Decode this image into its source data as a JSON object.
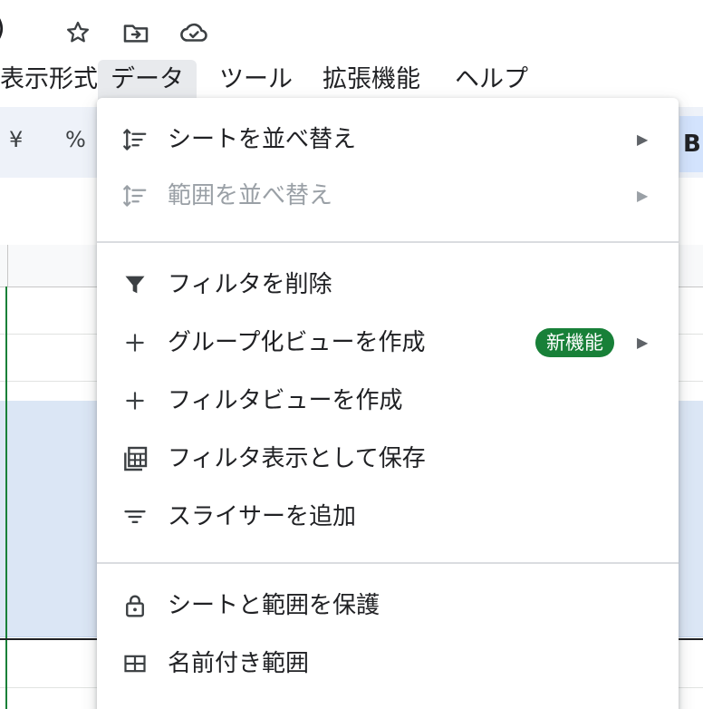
{
  "titlebar": {
    "paren": ")",
    "icons": [
      "star-icon",
      "move-to-folder-icon",
      "cloud-done-icon"
    ]
  },
  "menubar": {
    "items": [
      {
        "label": "表示形式"
      },
      {
        "label": "データ"
      },
      {
        "label": "ツール"
      },
      {
        "label": "拡張機能"
      },
      {
        "label": "ヘルプ"
      }
    ]
  },
  "toolbar": {
    "yen": "¥",
    "percent": "%",
    "bold": "B"
  },
  "dropdown": {
    "items": [
      {
        "label": "シートを並べ替え",
        "icon": "sort-icon",
        "submenu": true,
        "disabled": false
      },
      {
        "label": "範囲を並べ替え",
        "icon": "sort-range-icon",
        "submenu": true,
        "disabled": true
      },
      {
        "label": "フィルタを削除",
        "icon": "filter-icon",
        "submenu": false,
        "disabled": false
      },
      {
        "label": "グループ化ビューを作成",
        "icon": "plus-icon",
        "submenu": true,
        "disabled": false,
        "badge": "新機能"
      },
      {
        "label": "フィルタビューを作成",
        "icon": "plus-icon",
        "submenu": false,
        "disabled": false
      },
      {
        "label": "フィルタ表示として保存",
        "icon": "table-save-icon",
        "submenu": false,
        "disabled": false
      },
      {
        "label": "スライサーを追加",
        "icon": "slicer-icon",
        "submenu": false,
        "disabled": false
      },
      {
        "label": "シートと範囲を保護",
        "icon": "lock-icon",
        "submenu": false,
        "disabled": false
      },
      {
        "label": "名前付き範囲",
        "icon": "named-range-icon",
        "submenu": false,
        "disabled": false
      }
    ],
    "submenu_arrow": "▶"
  },
  "colors": {
    "accent_green": "#188038",
    "selection_blue": "#dbe6f5",
    "toolbar_bg": "#eef2f9"
  }
}
